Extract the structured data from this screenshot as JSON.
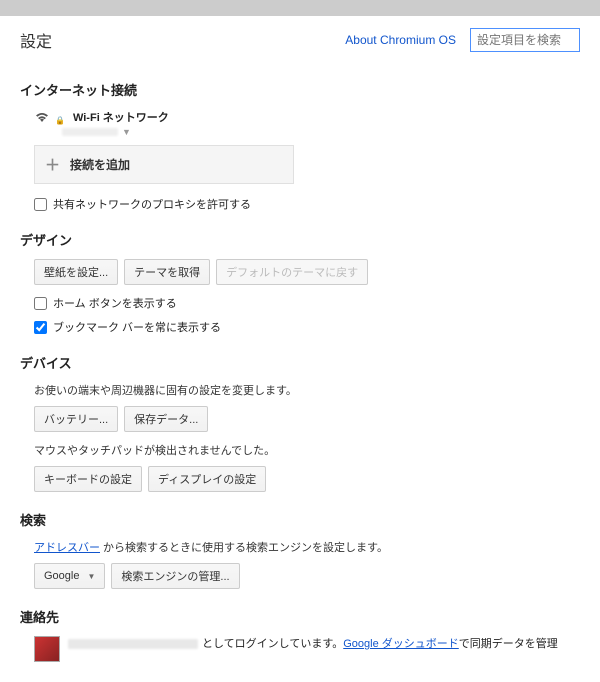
{
  "header": {
    "title": "設定",
    "about_link": "About Chromium OS",
    "search_placeholder": "設定項目を検索"
  },
  "sections": {
    "internet": {
      "title": "インターネット接続",
      "wifi_label": "Wi-Fi ネットワーク",
      "add_connection": "接続を追加",
      "proxy_checkbox": "共有ネットワークのプロキシを許可する"
    },
    "design": {
      "title": "デザイン",
      "set_wallpaper": "壁紙を設定...",
      "get_themes": "テーマを取得",
      "reset_theme": "デフォルトのテーマに戻す",
      "show_home": "ホーム ボタンを表示する",
      "show_bookmarks": "ブックマーク バーを常に表示する"
    },
    "device": {
      "title": "デバイス",
      "desc": "お使いの端末や周辺機器に固有の設定を変更します。",
      "battery": "バッテリー...",
      "stored_data": "保存データ...",
      "mouse_msg": "マウスやタッチパッドが検出されませんでした。",
      "keyboard": "キーボードの設定",
      "display": "ディスプレイの設定"
    },
    "search": {
      "title": "検索",
      "desc_pre": "アドレスバー",
      "desc_post": " から検索するときに使用する検索エンジンを設定します。",
      "engine": "Google",
      "manage": "検索エンジンの管理..."
    },
    "contacts": {
      "title": "連絡先",
      "login_suffix": " としてログインしています。",
      "dashboard_link": "Google ダッシュボード",
      "dashboard_suffix": "で同期データを管理"
    }
  }
}
